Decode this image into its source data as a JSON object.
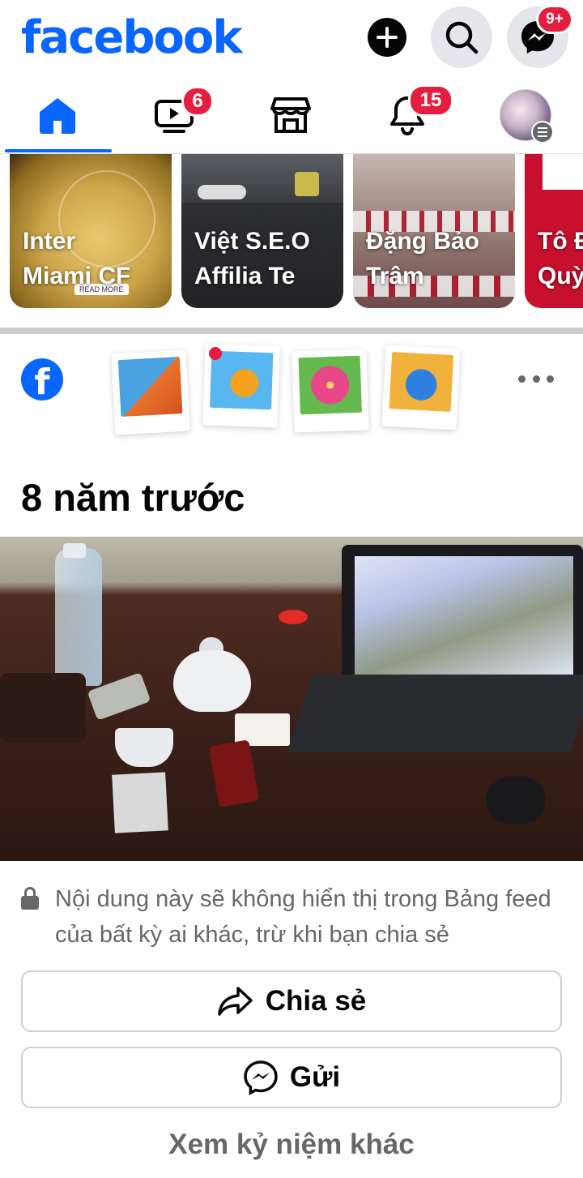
{
  "header": {
    "logo_text": "facebook",
    "messenger_badge": "9+",
    "icons": [
      "plus-icon",
      "search-icon",
      "messenger-icon"
    ]
  },
  "tabs": {
    "items": [
      "home",
      "watch",
      "marketplace",
      "notifications",
      "profile-menu"
    ],
    "watch_badge": "6",
    "notifications_badge": "15",
    "active": "home"
  },
  "stories": [
    {
      "label": "Inter Miami CF",
      "line1": "Inter",
      "line2": "Miami CF"
    },
    {
      "label": "Việt S.E.O Affilia Te",
      "line1": "Việt S.E.O",
      "line2": "Affilia Te"
    },
    {
      "label": "Đặng Bảo Trâm",
      "line1": "Đặng Bảo",
      "line2": "Trâm"
    },
    {
      "label": "Tô Đ... Quỳ...",
      "line1": "Tô Đ",
      "line2": "Quỳ"
    }
  ],
  "memory": {
    "years_ago": "8 năm trước",
    "privacy_note": "Nội dung này sẽ không hiển thị trong Bảng feed của bất kỳ ai khác, trừ khi bạn chia sẻ",
    "share_label": "Chia sẻ",
    "send_label": "Gửi",
    "see_more_label": "Xem kỷ niệm khác"
  },
  "colors": {
    "brand_blue": "#0866ff",
    "badge_red": "#e41e3f",
    "secondary_text": "#65676b"
  }
}
